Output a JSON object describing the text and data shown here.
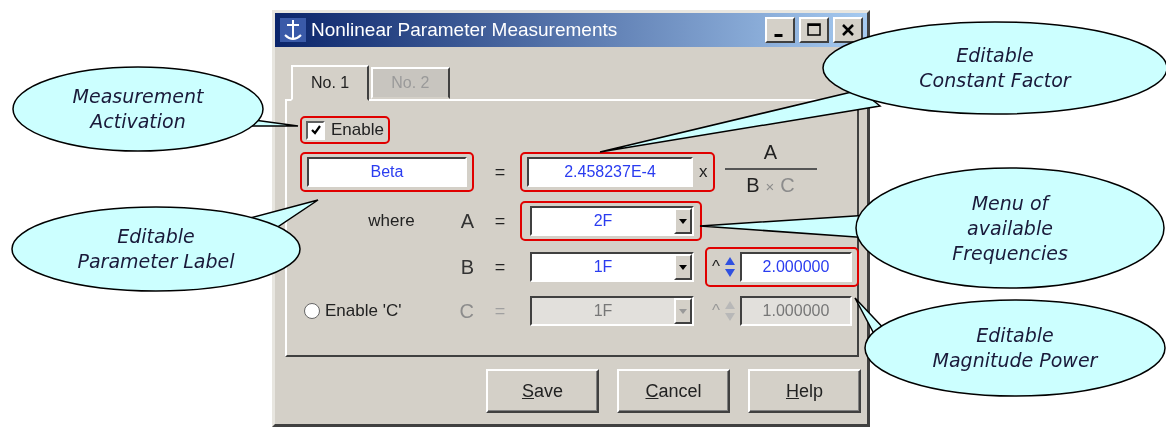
{
  "window": {
    "title": "Nonlinear Parameter Measurements"
  },
  "tabs": [
    {
      "label": "No. 1",
      "selected": true,
      "disabled": false
    },
    {
      "label": "No. 2",
      "selected": false,
      "disabled": true
    }
  ],
  "enable": {
    "label": "Enable",
    "checked": true,
    "highlighted": true
  },
  "formula": {
    "label_value": "Beta",
    "label_highlighted": true,
    "equals": "=",
    "constant_value": "2.458237E-4",
    "times": "x",
    "constant_highlighted": true,
    "numerator": "A",
    "denominator": [
      {
        "text": "B",
        "disabled": false
      },
      {
        "text": "×",
        "disabled": true
      },
      {
        "text": "C",
        "disabled": true
      }
    ]
  },
  "rows": [
    {
      "kind": "plain",
      "prefix": "where",
      "variable": "A",
      "equals": "=",
      "frequency": "2F",
      "frequency_highlighted": true,
      "disabled": false
    },
    {
      "kind": "power",
      "variable": "B",
      "equals": "=",
      "frequency": "1F",
      "frequency_highlighted": false,
      "caret": "^",
      "power": "2.000000",
      "power_highlighted": true,
      "disabled": false
    },
    {
      "kind": "optional",
      "radio_label": "Enable 'C'",
      "selected": false,
      "variable": "C",
      "equals": "=",
      "frequency": "1F",
      "frequency_highlighted": false,
      "caret": "^",
      "power": "1.000000",
      "power_highlighted": false,
      "disabled": true
    }
  ],
  "buttons": [
    {
      "mnemonic": "S",
      "rest": "ave"
    },
    {
      "mnemonic": "C",
      "rest": "ancel"
    },
    {
      "mnemonic": "H",
      "rest": "elp"
    }
  ],
  "callouts": [
    {
      "lines": [
        "Measurement",
        "Activation"
      ]
    },
    {
      "lines": [
        "Editable",
        "Parameter Label"
      ]
    },
    {
      "lines": [
        "Editable",
        "Constant Factor"
      ]
    },
    {
      "lines": [
        "Menu of",
        "available",
        "Frequencies"
      ]
    },
    {
      "lines": [
        "Editable",
        "Magnitude Power"
      ]
    }
  ]
}
